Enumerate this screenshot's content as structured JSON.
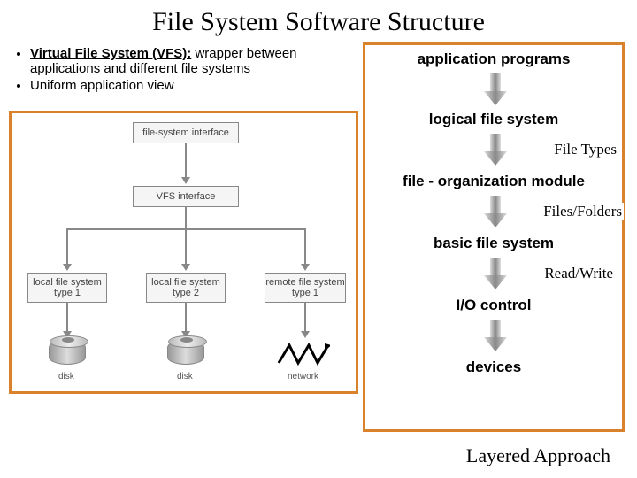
{
  "title": "File System Software Structure",
  "bullets": {
    "vfs_term": "Virtual File System (VFS):",
    "vfs_desc": " wrapper between applications and different file systems",
    "uniform": "Uniform application view"
  },
  "vfs_diagram": {
    "file_system_interface": "file-system interface",
    "vfs_interface": "VFS interface",
    "local_fs_1": "local file system\ntype 1",
    "local_fs_2": "local file system\ntype 2",
    "remote_fs": "remote file system\ntype 1",
    "disk_label": "disk",
    "network_label": "network"
  },
  "layers": {
    "application_programs": "application programs",
    "logical_file_system": "logical file system",
    "file_organization_module": "file - organization module",
    "basic_file_system": "basic file system",
    "io_control": "I/O control",
    "devices": "devices"
  },
  "annotations": {
    "file_types": "File Types",
    "files_folders": "Files/Folders",
    "read_write": "Read/Write"
  },
  "footer": "Layered Approach"
}
